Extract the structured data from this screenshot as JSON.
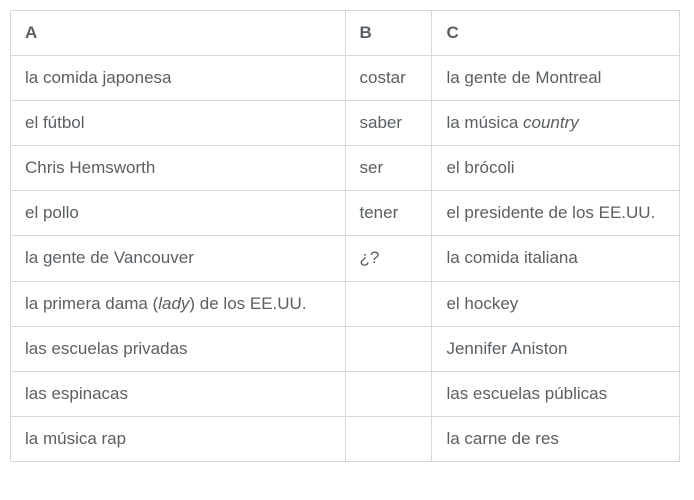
{
  "chart_data": {
    "type": "table",
    "headers": [
      "A",
      "B",
      "C"
    ],
    "rows": [
      {
        "a_parts": [
          {
            "t": "la comida japonesa",
            "i": false
          }
        ],
        "b": "costar",
        "c_parts": [
          {
            "t": "la gente de Montreal",
            "i": false
          }
        ]
      },
      {
        "a_parts": [
          {
            "t": "el fútbol",
            "i": false
          }
        ],
        "b": "saber",
        "c_parts": [
          {
            "t": "la música ",
            "i": false
          },
          {
            "t": "country",
            "i": true
          }
        ]
      },
      {
        "a_parts": [
          {
            "t": "Chris Hemsworth",
            "i": false
          }
        ],
        "b": "ser",
        "c_parts": [
          {
            "t": "el brócoli",
            "i": false
          }
        ]
      },
      {
        "a_parts": [
          {
            "t": "el pollo",
            "i": false
          }
        ],
        "b": "tener",
        "c_parts": [
          {
            "t": "el presidente de los EE.UU.",
            "i": false
          }
        ]
      },
      {
        "a_parts": [
          {
            "t": "la gente de Vancouver",
            "i": false
          }
        ],
        "b": "¿?",
        "c_parts": [
          {
            "t": "la comida italiana",
            "i": false
          }
        ]
      },
      {
        "a_parts": [
          {
            "t": "la primera dama (",
            "i": false
          },
          {
            "t": "lady",
            "i": true
          },
          {
            "t": ") de los EE.UU.",
            "i": false
          }
        ],
        "b": "",
        "c_parts": [
          {
            "t": "el hockey",
            "i": false
          }
        ]
      },
      {
        "a_parts": [
          {
            "t": "las escuelas privadas",
            "i": false
          }
        ],
        "b": "",
        "c_parts": [
          {
            "t": "Jennifer Aniston",
            "i": false
          }
        ]
      },
      {
        "a_parts": [
          {
            "t": "las espinacas",
            "i": false
          }
        ],
        "b": "",
        "c_parts": [
          {
            "t": "las escuelas públicas",
            "i": false
          }
        ]
      },
      {
        "a_parts": [
          {
            "t": "la música rap",
            "i": false
          }
        ],
        "b": "",
        "c_parts": [
          {
            "t": "la carne de res",
            "i": false
          }
        ]
      }
    ]
  }
}
